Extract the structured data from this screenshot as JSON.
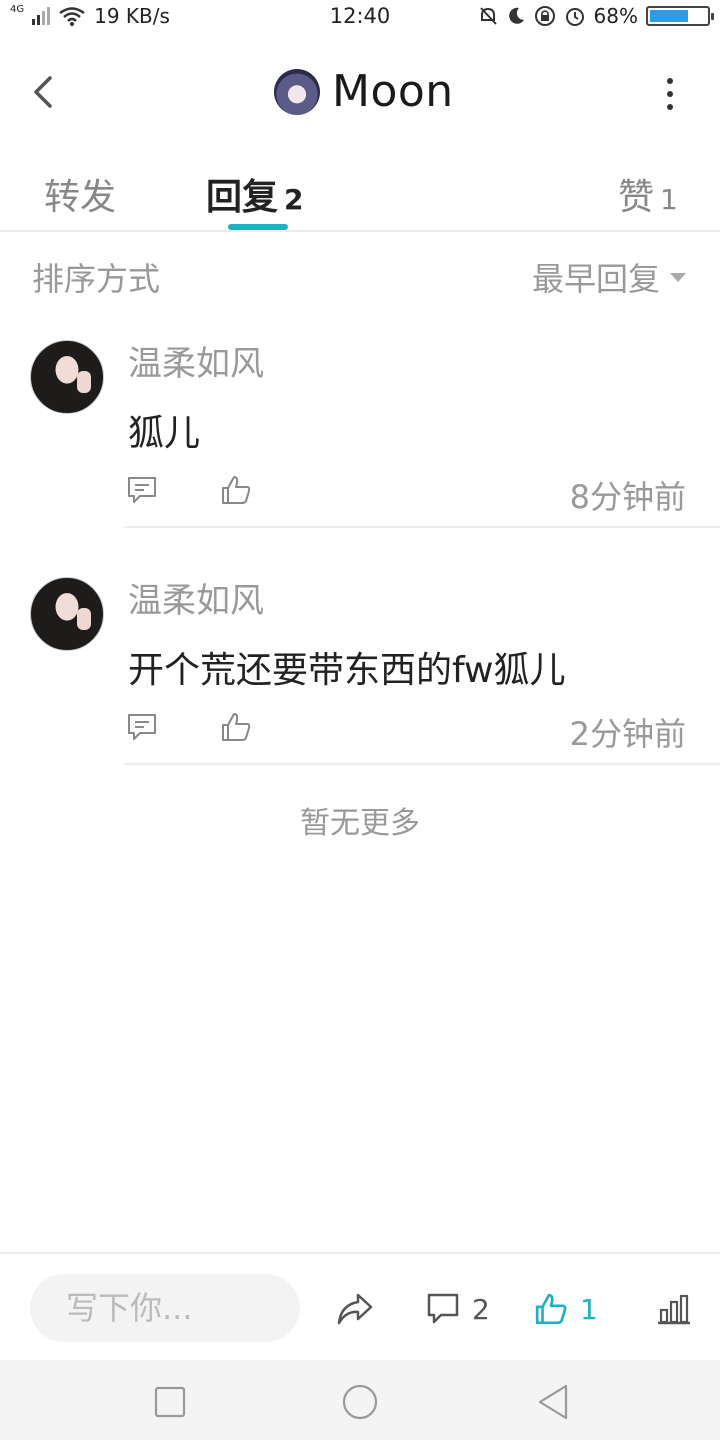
{
  "status_bar": {
    "network": "4G",
    "speed": "19 KB/s",
    "time": "12:40",
    "battery": "68%",
    "battery_level": 0.68,
    "icons": [
      "signal-icon",
      "wifi-icon",
      "mute-icon",
      "moon-icon",
      "lock-rotation-icon",
      "alarm-icon",
      "battery-icon"
    ]
  },
  "header": {
    "title": "Moon"
  },
  "tabs": [
    {
      "label": "转发",
      "count": ""
    },
    {
      "label": "回复",
      "count": "2"
    },
    {
      "label": "赞",
      "count": "1"
    }
  ],
  "sort": {
    "label": "排序方式",
    "value": "最早回复"
  },
  "replies": [
    {
      "name": "温柔如风",
      "text": "狐儿",
      "time": "8分钟前"
    },
    {
      "name": "温柔如风",
      "text": "开个荒还要带东西的fw狐儿",
      "time": "2分钟前"
    }
  ],
  "no_more": "暂无更多",
  "bottom_bar": {
    "input_placeholder": "写下你...",
    "comment_count": "2",
    "like_count": "1",
    "accent_color": "#1fb0c2"
  }
}
